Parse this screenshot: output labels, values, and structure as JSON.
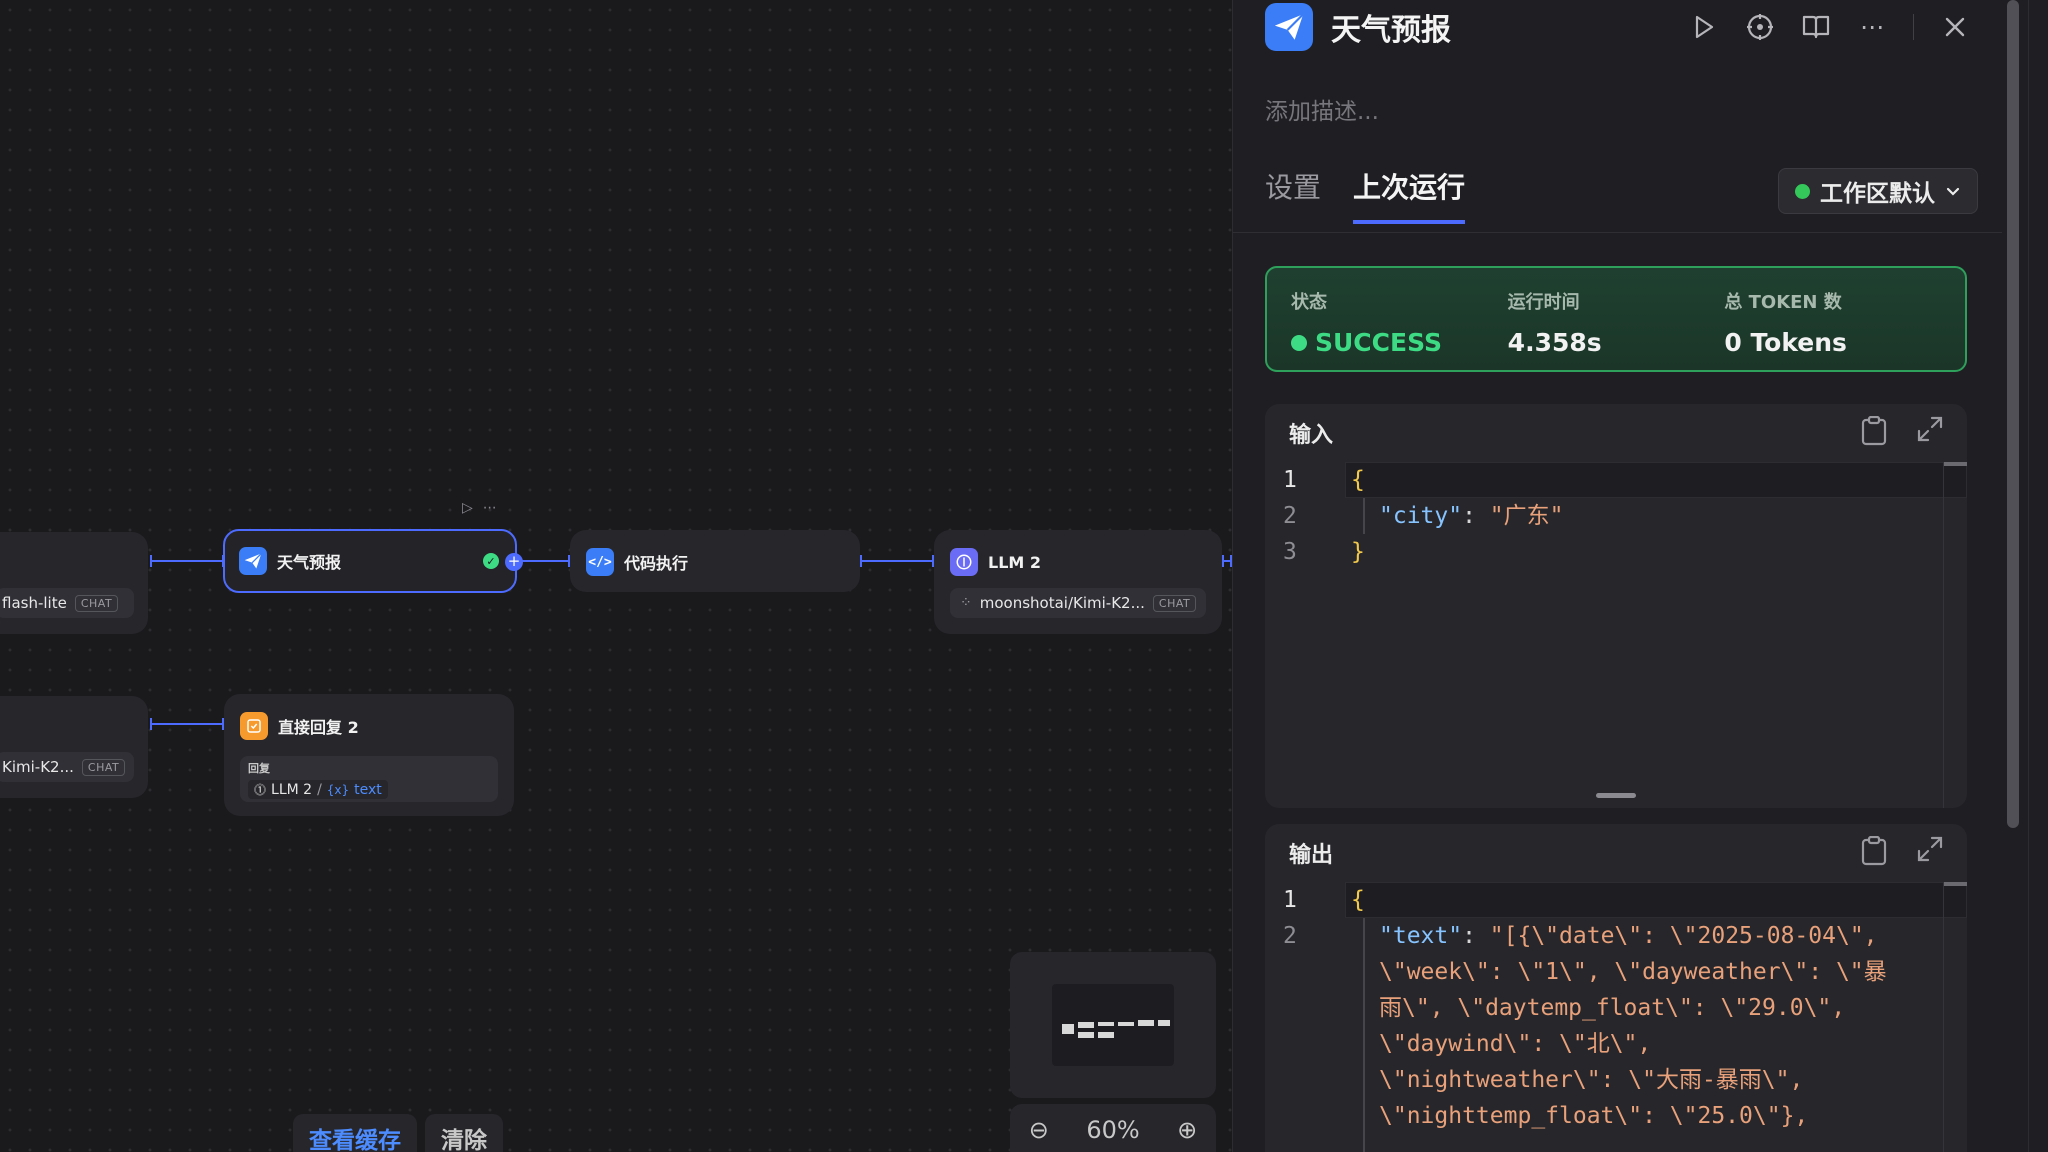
{
  "canvas": {
    "nodes": {
      "left_top_model": "flash-lite",
      "left_top_tag": "CHAT",
      "left_bottom_model": "Kimi-K2...",
      "left_bottom_tag": "CHAT",
      "weather": {
        "title": "天气预报"
      },
      "code_exec": {
        "title": "代码执行"
      },
      "llm2": {
        "title": "LLM 2",
        "model": "moonshotai/Kimi-K2...",
        "tag": "CHAT"
      },
      "reply2": {
        "title": "直接回复 2",
        "section_label": "回复",
        "ref_node": "LLM 2",
        "ref_sep": "/",
        "ref_var_icon": "{x}",
        "ref_var": "text"
      }
    },
    "cache_bar": {
      "view_cache": "查看缓存",
      "clear": "清除"
    },
    "zoom": {
      "level": "60%"
    }
  },
  "panel": {
    "title": "天气预报",
    "description_placeholder": "添加描述...",
    "tabs": [
      {
        "label": "设置"
      },
      {
        "label": "上次运行"
      }
    ],
    "workspace_select": "工作区默认",
    "status": {
      "status_label": "状态",
      "status_value": "SUCCESS",
      "runtime_label": "运行时间",
      "runtime_value": "4.358s",
      "tokens_label": "总 TOKEN 数",
      "tokens_value": "0 Tokens"
    },
    "input": {
      "title": "输入",
      "lines": [
        "1",
        "2",
        "3"
      ],
      "open_brace": "{",
      "key": "\"city\"",
      "colon": ": ",
      "value": "\"广东\"",
      "close_brace": "}"
    },
    "output": {
      "title": "输出",
      "lines": [
        "1",
        "2"
      ],
      "open_brace": "{",
      "key": "\"text\"",
      "colon": ": ",
      "wrapped": [
        "\"[{\\\"date\\\": \\\"2025-08-04\\\",",
        "\\\"week\\\": \\\"1\\\", \\\"dayweather\\\": \\\"暴",
        "雨\\\", \\\"daytemp_float\\\": \\\"29.0\\\",",
        "\\\"daywind\\\": \\\"北\\\",",
        "\\\"nightweather\\\": \\\"大雨-暴雨\\\",",
        "\\\"nighttemp_float\\\": \\\"25.0\\\"},"
      ]
    }
  },
  "colors": {
    "accent": "#4d6bfe",
    "success": "#3ddc84",
    "brand_icon": "#3a7df6"
  }
}
